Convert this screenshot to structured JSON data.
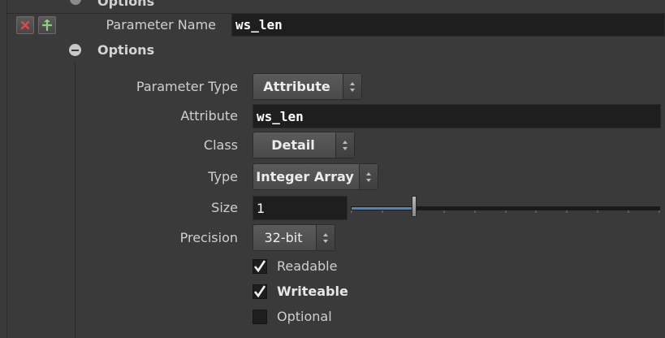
{
  "header": {
    "top_folder_label": "Options",
    "parameter_name_label": "Parameter Name",
    "parameter_name_value": "ws_len"
  },
  "options_section": {
    "title": "Options"
  },
  "form": {
    "parameter_type": {
      "label": "Parameter Type",
      "value": "Attribute"
    },
    "attribute": {
      "label": "Attribute",
      "value": "ws_len"
    },
    "class": {
      "label": "Class",
      "value": "Detail"
    },
    "type": {
      "label": "Type",
      "value": "Integer Array"
    },
    "size": {
      "label": "Size",
      "value": "1",
      "slider_fraction": 0.1
    },
    "precision": {
      "label": "Precision",
      "value": "32-bit"
    },
    "readable": {
      "label": "Readable",
      "checked": true
    },
    "writeable": {
      "label": "Writeable",
      "checked": true
    },
    "optional": {
      "label": "Optional",
      "checked": false
    }
  },
  "icons": {
    "delete": "close-icon",
    "add": "add-icon"
  },
  "colors": {
    "background": "#3a3a3a",
    "field_bg": "#1e1e1e",
    "delete_red": "#d04040",
    "add_green": "#7ac070",
    "slider_blue": "#3f6f9f"
  }
}
